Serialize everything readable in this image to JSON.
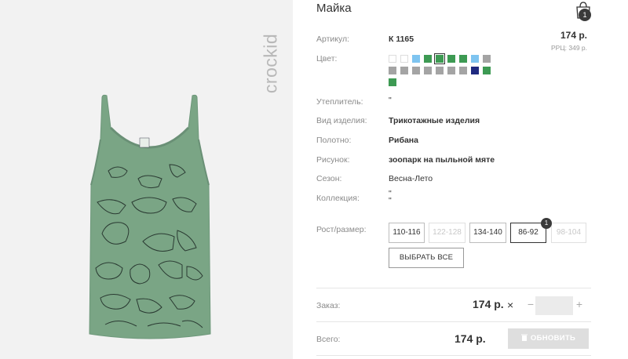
{
  "brand": "crockid",
  "product": {
    "title": "Майка"
  },
  "cart": {
    "icon": "shopping-bag-icon",
    "badge": "1"
  },
  "details": {
    "article_label": "Артикул:",
    "article_value": "К 1165",
    "price": "174 р.",
    "rrp": "РРЦ: 349 р.",
    "color_label": "Цвет:",
    "insulation_label": "Утеплитель:",
    "insulation_value": "\"",
    "type_label": "Вид изделия:",
    "type_value": "Трикотажные изделия",
    "fabric_label": "Полотно:",
    "fabric_value": "Рибана",
    "pattern_label": "Рисунок:",
    "pattern_value": "зоопарк на пыльной мяте",
    "season_label": "Сезон:",
    "season_value": "Весна-Лето",
    "collection_label": "Коллекция:",
    "collection_value": "\"\n\"",
    "size_label": "Рост/размер:"
  },
  "colors": [
    "#ffffff",
    "#ffffff",
    "#7ec4f0",
    "#3d9a53",
    "#3d9a53",
    "#3d9a53",
    "#3d9a53",
    "#7ec4f0",
    "#a4a4a4",
    "#a4a4a4",
    "#a4a4a4",
    "#a4a4a4",
    "#a4a4a4",
    "#a4a4a4",
    "#a4a4a4",
    "#a4a4a4",
    "#1f2a80",
    "#3d9a53",
    "#3d9a53"
  ],
  "selected_color_index": 4,
  "sizes": [
    {
      "label": "110-116",
      "state": "available"
    },
    {
      "label": "122-128",
      "state": "disabled"
    },
    {
      "label": "134-140",
      "state": "available"
    },
    {
      "label": "86-92",
      "state": "active",
      "badge": "1"
    },
    {
      "label": "98-104",
      "state": "disabled"
    }
  ],
  "select_all": "ВЫБРАТЬ ВСЕ",
  "order": {
    "label": "Заказ:",
    "price": "174 р.",
    "times": "×",
    "minus": "−",
    "plus": "+",
    "qty": ""
  },
  "total": {
    "label": "Всего:",
    "price": "174 р.",
    "button": "ОБНОВИТЬ"
  },
  "theme": {
    "product_color": "#7aa585",
    "accent": "#3a3a3a"
  }
}
